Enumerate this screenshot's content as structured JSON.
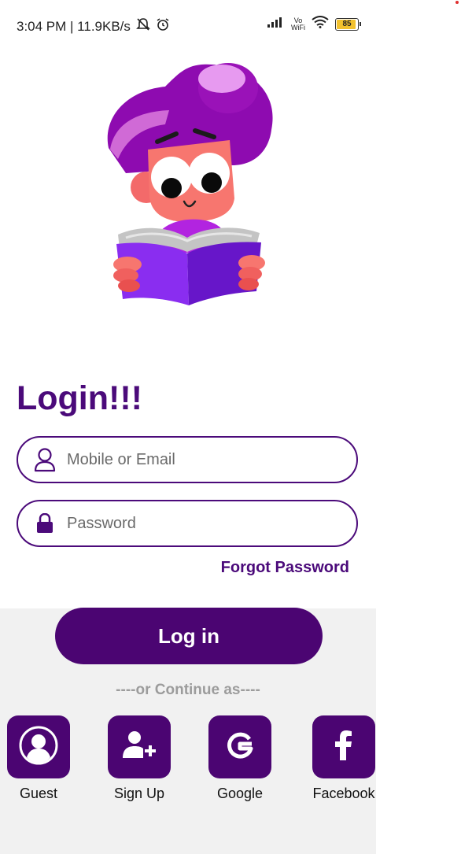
{
  "status": {
    "time_speed": "3:04 PM | 11.9KB/s",
    "vowifi_top": "Vo",
    "vowifi_bottom": "WiFi",
    "battery": "85"
  },
  "login": {
    "title": "Login!!!",
    "email_placeholder": "Mobile or Email",
    "password_placeholder": "Password",
    "forgot": "Forgot Password",
    "button": "Log in"
  },
  "continue": {
    "divider": "----or Continue as----",
    "options": [
      {
        "label": "Guest",
        "icon": "guest-icon"
      },
      {
        "label": "Sign Up",
        "icon": "add-user-icon"
      },
      {
        "label": "Google",
        "icon": "google-icon"
      },
      {
        "label": "Facebook",
        "icon": "facebook-icon"
      }
    ]
  },
  "colors": {
    "brand": "#4b0572",
    "background_bottom": "#f1f1f1"
  }
}
